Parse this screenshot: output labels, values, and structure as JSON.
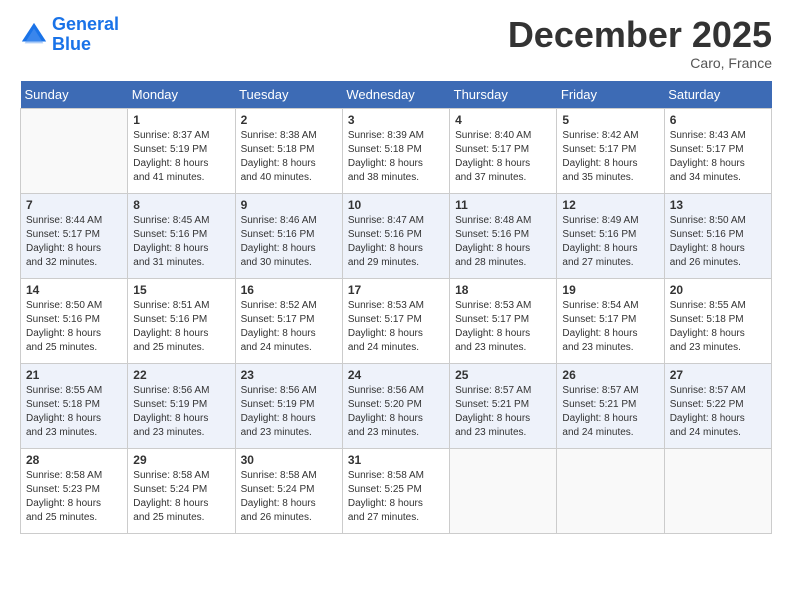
{
  "header": {
    "logo_line1": "General",
    "logo_line2": "Blue",
    "month": "December 2025",
    "location": "Caro, France"
  },
  "days_of_week": [
    "Sunday",
    "Monday",
    "Tuesday",
    "Wednesday",
    "Thursday",
    "Friday",
    "Saturday"
  ],
  "weeks": [
    [
      {
        "day": "",
        "info": ""
      },
      {
        "day": "1",
        "info": "Sunrise: 8:37 AM\nSunset: 5:19 PM\nDaylight: 8 hours\nand 41 minutes."
      },
      {
        "day": "2",
        "info": "Sunrise: 8:38 AM\nSunset: 5:18 PM\nDaylight: 8 hours\nand 40 minutes."
      },
      {
        "day": "3",
        "info": "Sunrise: 8:39 AM\nSunset: 5:18 PM\nDaylight: 8 hours\nand 38 minutes."
      },
      {
        "day": "4",
        "info": "Sunrise: 8:40 AM\nSunset: 5:17 PM\nDaylight: 8 hours\nand 37 minutes."
      },
      {
        "day": "5",
        "info": "Sunrise: 8:42 AM\nSunset: 5:17 PM\nDaylight: 8 hours\nand 35 minutes."
      },
      {
        "day": "6",
        "info": "Sunrise: 8:43 AM\nSunset: 5:17 PM\nDaylight: 8 hours\nand 34 minutes."
      }
    ],
    [
      {
        "day": "7",
        "info": "Sunrise: 8:44 AM\nSunset: 5:17 PM\nDaylight: 8 hours\nand 32 minutes."
      },
      {
        "day": "8",
        "info": "Sunrise: 8:45 AM\nSunset: 5:16 PM\nDaylight: 8 hours\nand 31 minutes."
      },
      {
        "day": "9",
        "info": "Sunrise: 8:46 AM\nSunset: 5:16 PM\nDaylight: 8 hours\nand 30 minutes."
      },
      {
        "day": "10",
        "info": "Sunrise: 8:47 AM\nSunset: 5:16 PM\nDaylight: 8 hours\nand 29 minutes."
      },
      {
        "day": "11",
        "info": "Sunrise: 8:48 AM\nSunset: 5:16 PM\nDaylight: 8 hours\nand 28 minutes."
      },
      {
        "day": "12",
        "info": "Sunrise: 8:49 AM\nSunset: 5:16 PM\nDaylight: 8 hours\nand 27 minutes."
      },
      {
        "day": "13",
        "info": "Sunrise: 8:50 AM\nSunset: 5:16 PM\nDaylight: 8 hours\nand 26 minutes."
      }
    ],
    [
      {
        "day": "14",
        "info": "Sunrise: 8:50 AM\nSunset: 5:16 PM\nDaylight: 8 hours\nand 25 minutes."
      },
      {
        "day": "15",
        "info": "Sunrise: 8:51 AM\nSunset: 5:16 PM\nDaylight: 8 hours\nand 25 minutes."
      },
      {
        "day": "16",
        "info": "Sunrise: 8:52 AM\nSunset: 5:17 PM\nDaylight: 8 hours\nand 24 minutes."
      },
      {
        "day": "17",
        "info": "Sunrise: 8:53 AM\nSunset: 5:17 PM\nDaylight: 8 hours\nand 24 minutes."
      },
      {
        "day": "18",
        "info": "Sunrise: 8:53 AM\nSunset: 5:17 PM\nDaylight: 8 hours\nand 23 minutes."
      },
      {
        "day": "19",
        "info": "Sunrise: 8:54 AM\nSunset: 5:17 PM\nDaylight: 8 hours\nand 23 minutes."
      },
      {
        "day": "20",
        "info": "Sunrise: 8:55 AM\nSunset: 5:18 PM\nDaylight: 8 hours\nand 23 minutes."
      }
    ],
    [
      {
        "day": "21",
        "info": "Sunrise: 8:55 AM\nSunset: 5:18 PM\nDaylight: 8 hours\nand 23 minutes."
      },
      {
        "day": "22",
        "info": "Sunrise: 8:56 AM\nSunset: 5:19 PM\nDaylight: 8 hours\nand 23 minutes."
      },
      {
        "day": "23",
        "info": "Sunrise: 8:56 AM\nSunset: 5:19 PM\nDaylight: 8 hours\nand 23 minutes."
      },
      {
        "day": "24",
        "info": "Sunrise: 8:56 AM\nSunset: 5:20 PM\nDaylight: 8 hours\nand 23 minutes."
      },
      {
        "day": "25",
        "info": "Sunrise: 8:57 AM\nSunset: 5:21 PM\nDaylight: 8 hours\nand 23 minutes."
      },
      {
        "day": "26",
        "info": "Sunrise: 8:57 AM\nSunset: 5:21 PM\nDaylight: 8 hours\nand 24 minutes."
      },
      {
        "day": "27",
        "info": "Sunrise: 8:57 AM\nSunset: 5:22 PM\nDaylight: 8 hours\nand 24 minutes."
      }
    ],
    [
      {
        "day": "28",
        "info": "Sunrise: 8:58 AM\nSunset: 5:23 PM\nDaylight: 8 hours\nand 25 minutes."
      },
      {
        "day": "29",
        "info": "Sunrise: 8:58 AM\nSunset: 5:24 PM\nDaylight: 8 hours\nand 25 minutes."
      },
      {
        "day": "30",
        "info": "Sunrise: 8:58 AM\nSunset: 5:24 PM\nDaylight: 8 hours\nand 26 minutes."
      },
      {
        "day": "31",
        "info": "Sunrise: 8:58 AM\nSunset: 5:25 PM\nDaylight: 8 hours\nand 27 minutes."
      },
      {
        "day": "",
        "info": ""
      },
      {
        "day": "",
        "info": ""
      },
      {
        "day": "",
        "info": ""
      }
    ]
  ]
}
